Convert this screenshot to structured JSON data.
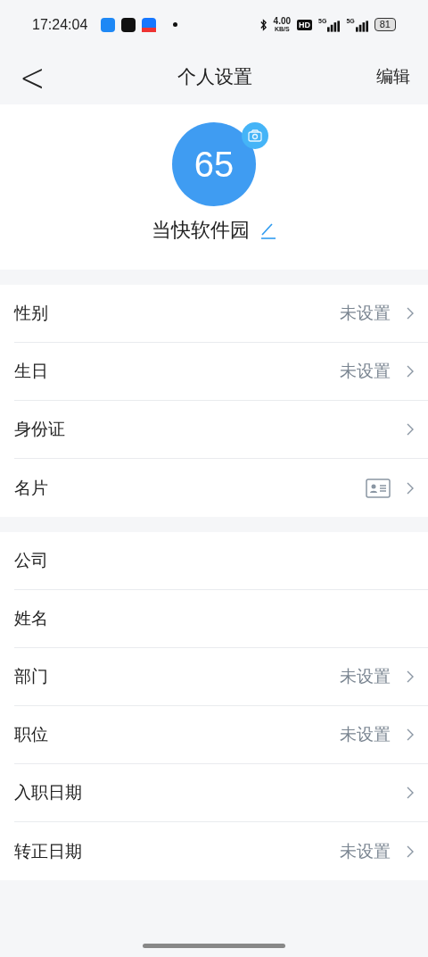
{
  "status_bar": {
    "time": "17:24:04",
    "speed": "4.00",
    "speed_unit": "KB/S",
    "hd": "HD",
    "networks": [
      "5G",
      "5G"
    ],
    "battery": "81"
  },
  "nav": {
    "back": "<",
    "title": "个人设置",
    "action": "编辑"
  },
  "profile": {
    "avatar": "65",
    "name": "当快软件园"
  },
  "groups": [
    [
      {
        "label": "性别",
        "value": "未设置",
        "kind": "text",
        "chevron": true
      },
      {
        "label": "生日",
        "value": "未设置",
        "kind": "text",
        "chevron": true
      },
      {
        "label": "身份证",
        "kind": "text",
        "chevron": true
      },
      {
        "label": "名片",
        "kind": "card",
        "chevron": true
      }
    ],
    [
      {
        "label": "公司",
        "kind": "text",
        "chevron": false
      },
      {
        "label": "姓名",
        "kind": "text",
        "chevron": false
      },
      {
        "label": "部门",
        "value": "未设置",
        "kind": "text",
        "chevron": true
      },
      {
        "label": "职位",
        "value": "未设置",
        "kind": "text",
        "chevron": true
      },
      {
        "label": "入职日期",
        "kind": "text",
        "chevron": true
      },
      {
        "label": "转正日期",
        "value": "未设置",
        "kind": "text",
        "chevron": true
      }
    ]
  ]
}
